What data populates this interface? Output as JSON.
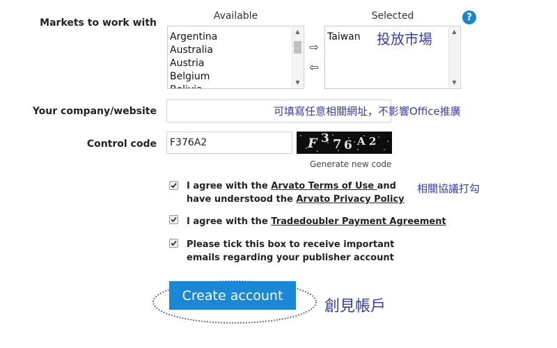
{
  "markets": {
    "label": "Markets to work with",
    "available_header": "Available",
    "selected_header": "Selected",
    "available_items": [
      "Argentina",
      "Australia",
      "Austria",
      "Belgium",
      "Bolivia"
    ],
    "selected_items": [
      "Taiwan"
    ],
    "add_arrow": "⇨",
    "remove_arrow": "⇦",
    "help": "?",
    "annotation": "投放市場"
  },
  "company": {
    "label": "Your company/website",
    "value": "",
    "annotation": "可填寫任意相關網址，不影響Office推廣"
  },
  "control": {
    "label": "Control code",
    "value": "F376A2",
    "captcha_chars": [
      "F",
      "3",
      "7",
      "6",
      "A",
      "2"
    ],
    "generate_link": "Generate new code"
  },
  "agreements": {
    "annotation": "相關協議打勾",
    "terms": {
      "text_1": "I agree with the ",
      "link_1": "Arvato Terms of Use ",
      "text_2": "and have understood the ",
      "link_2": "Arvato Privacy Policy",
      "checked": true
    },
    "payment": {
      "text_1": "I agree with the ",
      "link_1": "Tradedoubler Payment Agreement",
      "checked": true
    },
    "emails": {
      "text": "Please tick this box to receive important emails regarding your publisher account",
      "checked": true
    }
  },
  "submit": {
    "label": "Create account",
    "annotation": "創見帳戶",
    "brand_color": "#1a88d4",
    "annotation_color": "#3b3ba8"
  }
}
